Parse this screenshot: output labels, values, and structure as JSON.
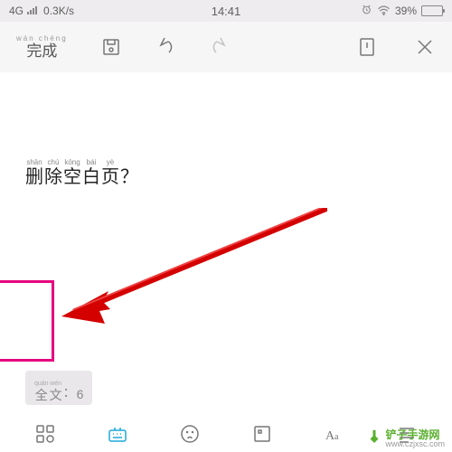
{
  "status": {
    "network": "4G",
    "speed": "0.3K/s",
    "time": "14:41",
    "battery_pct": "39%"
  },
  "toolbar": {
    "done": {
      "pinyin": "wán chéng",
      "label": "完成"
    }
  },
  "content": {
    "question_chars": [
      {
        "py": "shān",
        "hz": "删"
      },
      {
        "py": "chú",
        "hz": "除"
      },
      {
        "py": "kōng",
        "hz": "空"
      },
      {
        "py": "bái",
        "hz": "白"
      },
      {
        "py": "yè",
        "hz": "页"
      }
    ],
    "question_tail": "？",
    "quanwen_chars": [
      {
        "py": "quán",
        "hz": "全"
      },
      {
        "py": "wén",
        "hz": "文"
      }
    ],
    "quanwen_sep": "：",
    "quanwen_count": "6"
  },
  "watermark": {
    "title": "铲子手游网",
    "url": "www.czjxsc.com"
  }
}
